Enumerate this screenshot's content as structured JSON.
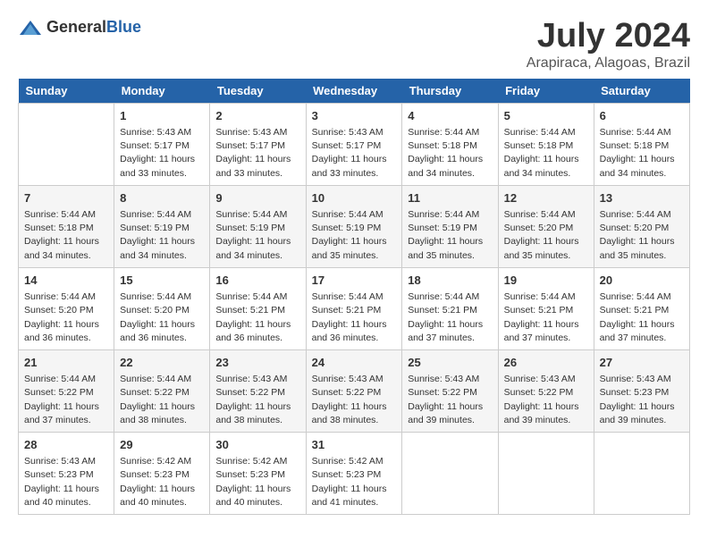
{
  "logo": {
    "general": "General",
    "blue": "Blue"
  },
  "title": "July 2024",
  "subtitle": "Arapiraca, Alagoas, Brazil",
  "days_header": [
    "Sunday",
    "Monday",
    "Tuesday",
    "Wednesday",
    "Thursday",
    "Friday",
    "Saturday"
  ],
  "weeks": [
    [
      {
        "num": "",
        "info": ""
      },
      {
        "num": "1",
        "info": "Sunrise: 5:43 AM\nSunset: 5:17 PM\nDaylight: 11 hours\nand 33 minutes."
      },
      {
        "num": "2",
        "info": "Sunrise: 5:43 AM\nSunset: 5:17 PM\nDaylight: 11 hours\nand 33 minutes."
      },
      {
        "num": "3",
        "info": "Sunrise: 5:43 AM\nSunset: 5:17 PM\nDaylight: 11 hours\nand 33 minutes."
      },
      {
        "num": "4",
        "info": "Sunrise: 5:44 AM\nSunset: 5:18 PM\nDaylight: 11 hours\nand 34 minutes."
      },
      {
        "num": "5",
        "info": "Sunrise: 5:44 AM\nSunset: 5:18 PM\nDaylight: 11 hours\nand 34 minutes."
      },
      {
        "num": "6",
        "info": "Sunrise: 5:44 AM\nSunset: 5:18 PM\nDaylight: 11 hours\nand 34 minutes."
      }
    ],
    [
      {
        "num": "7",
        "info": "Sunrise: 5:44 AM\nSunset: 5:18 PM\nDaylight: 11 hours\nand 34 minutes."
      },
      {
        "num": "8",
        "info": "Sunrise: 5:44 AM\nSunset: 5:19 PM\nDaylight: 11 hours\nand 34 minutes."
      },
      {
        "num": "9",
        "info": "Sunrise: 5:44 AM\nSunset: 5:19 PM\nDaylight: 11 hours\nand 34 minutes."
      },
      {
        "num": "10",
        "info": "Sunrise: 5:44 AM\nSunset: 5:19 PM\nDaylight: 11 hours\nand 35 minutes."
      },
      {
        "num": "11",
        "info": "Sunrise: 5:44 AM\nSunset: 5:19 PM\nDaylight: 11 hours\nand 35 minutes."
      },
      {
        "num": "12",
        "info": "Sunrise: 5:44 AM\nSunset: 5:20 PM\nDaylight: 11 hours\nand 35 minutes."
      },
      {
        "num": "13",
        "info": "Sunrise: 5:44 AM\nSunset: 5:20 PM\nDaylight: 11 hours\nand 35 minutes."
      }
    ],
    [
      {
        "num": "14",
        "info": "Sunrise: 5:44 AM\nSunset: 5:20 PM\nDaylight: 11 hours\nand 36 minutes."
      },
      {
        "num": "15",
        "info": "Sunrise: 5:44 AM\nSunset: 5:20 PM\nDaylight: 11 hours\nand 36 minutes."
      },
      {
        "num": "16",
        "info": "Sunrise: 5:44 AM\nSunset: 5:21 PM\nDaylight: 11 hours\nand 36 minutes."
      },
      {
        "num": "17",
        "info": "Sunrise: 5:44 AM\nSunset: 5:21 PM\nDaylight: 11 hours\nand 36 minutes."
      },
      {
        "num": "18",
        "info": "Sunrise: 5:44 AM\nSunset: 5:21 PM\nDaylight: 11 hours\nand 37 minutes."
      },
      {
        "num": "19",
        "info": "Sunrise: 5:44 AM\nSunset: 5:21 PM\nDaylight: 11 hours\nand 37 minutes."
      },
      {
        "num": "20",
        "info": "Sunrise: 5:44 AM\nSunset: 5:21 PM\nDaylight: 11 hours\nand 37 minutes."
      }
    ],
    [
      {
        "num": "21",
        "info": "Sunrise: 5:44 AM\nSunset: 5:22 PM\nDaylight: 11 hours\nand 37 minutes."
      },
      {
        "num": "22",
        "info": "Sunrise: 5:44 AM\nSunset: 5:22 PM\nDaylight: 11 hours\nand 38 minutes."
      },
      {
        "num": "23",
        "info": "Sunrise: 5:43 AM\nSunset: 5:22 PM\nDaylight: 11 hours\nand 38 minutes."
      },
      {
        "num": "24",
        "info": "Sunrise: 5:43 AM\nSunset: 5:22 PM\nDaylight: 11 hours\nand 38 minutes."
      },
      {
        "num": "25",
        "info": "Sunrise: 5:43 AM\nSunset: 5:22 PM\nDaylight: 11 hours\nand 39 minutes."
      },
      {
        "num": "26",
        "info": "Sunrise: 5:43 AM\nSunset: 5:22 PM\nDaylight: 11 hours\nand 39 minutes."
      },
      {
        "num": "27",
        "info": "Sunrise: 5:43 AM\nSunset: 5:23 PM\nDaylight: 11 hours\nand 39 minutes."
      }
    ],
    [
      {
        "num": "28",
        "info": "Sunrise: 5:43 AM\nSunset: 5:23 PM\nDaylight: 11 hours\nand 40 minutes."
      },
      {
        "num": "29",
        "info": "Sunrise: 5:42 AM\nSunset: 5:23 PM\nDaylight: 11 hours\nand 40 minutes."
      },
      {
        "num": "30",
        "info": "Sunrise: 5:42 AM\nSunset: 5:23 PM\nDaylight: 11 hours\nand 40 minutes."
      },
      {
        "num": "31",
        "info": "Sunrise: 5:42 AM\nSunset: 5:23 PM\nDaylight: 11 hours\nand 41 minutes."
      },
      {
        "num": "",
        "info": ""
      },
      {
        "num": "",
        "info": ""
      },
      {
        "num": "",
        "info": ""
      }
    ]
  ]
}
